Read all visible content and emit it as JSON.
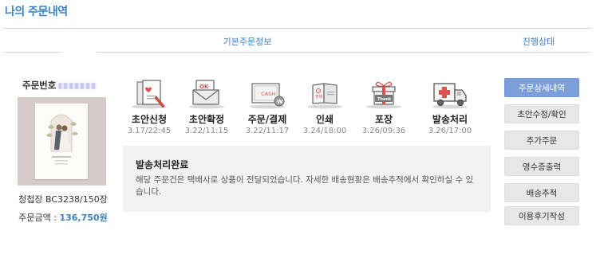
{
  "page": {
    "title": "나의 주문내역"
  },
  "tabs": {
    "basic": "기본주문정보",
    "status": "진행상태"
  },
  "order": {
    "number_label": "주문번호",
    "product_name": "청첩장 BC3238/150장",
    "price_label": "주문금액 : ",
    "price_value": "136,750원"
  },
  "steps": [
    {
      "icon": "card-pen-icon",
      "label": "초안신청",
      "time": "3.17/22:45"
    },
    {
      "icon": "ok-envelope-icon",
      "label": "초안확정",
      "time": "3.22/11:15"
    },
    {
      "icon": "cash-card-icon",
      "label": "주문/결제",
      "time": "3.22/11:17"
    },
    {
      "icon": "print-card-icon",
      "label": "인쇄",
      "time": "3.24/18:00"
    },
    {
      "icon": "gift-box-icon",
      "label": "포장",
      "time": "3.26/09:36"
    },
    {
      "icon": "delivery-truck-icon",
      "label": "발송처리",
      "time": "3.26/17:00"
    }
  ],
  "notice": {
    "title": "발송처리완료",
    "description": "해당 주문건은 택배사로 상품이 전달되었습니다. 자세한 배송현황은 배송추적에서 확인하실 수 있습니다."
  },
  "buttons": [
    {
      "label": "주문상세내역",
      "primary": true
    },
    {
      "label": "초안수정/확인",
      "primary": false
    },
    {
      "label": "추가주문",
      "primary": false
    },
    {
      "label": "영수증출력",
      "primary": false
    },
    {
      "label": "배송추적",
      "primary": false
    },
    {
      "label": "이용후기작성",
      "primary": false
    }
  ],
  "colors": {
    "accent": "#3b82c4",
    "primary_button": "#7d9fd9",
    "button": "#e7e7e7",
    "notice_bg": "#f2f2f2"
  }
}
